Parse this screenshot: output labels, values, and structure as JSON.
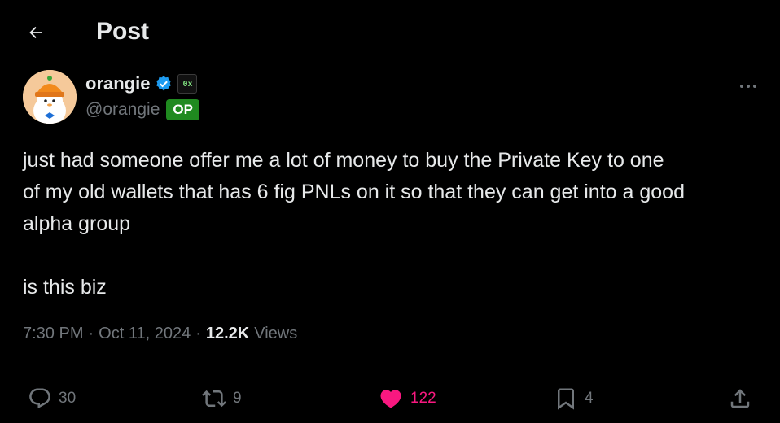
{
  "header": {
    "title": "Post",
    "back_icon": "arrow-left-icon"
  },
  "author": {
    "name": "orangie",
    "handle": "@orangie",
    "badge_label": "OP",
    "verified_icon": "verified-badge-icon",
    "affiliate_badge": "0x",
    "avatar_icon": "penguin-avatar"
  },
  "tweet": {
    "text": "just had someone offer me a lot of money to buy the Private Key to one\nof my old wallets that has 6 fig PNLs on it so that they can get into a good\nalpha group\n\nis this biz"
  },
  "meta": {
    "time": "7:30 PM",
    "separator": "·",
    "date": "Oct 11, 2024",
    "separator2": "·",
    "views_count": "12.2K",
    "views_label": "Views"
  },
  "actions": {
    "replies": "30",
    "reposts": "9",
    "likes": "122",
    "bookmarks": "4"
  },
  "colors": {
    "background": "#000000",
    "text": "#e7e9ea",
    "muted": "#71767b",
    "like": "#f91880",
    "verified": "#1d9bf0",
    "op_badge": "#1f8a1f"
  }
}
